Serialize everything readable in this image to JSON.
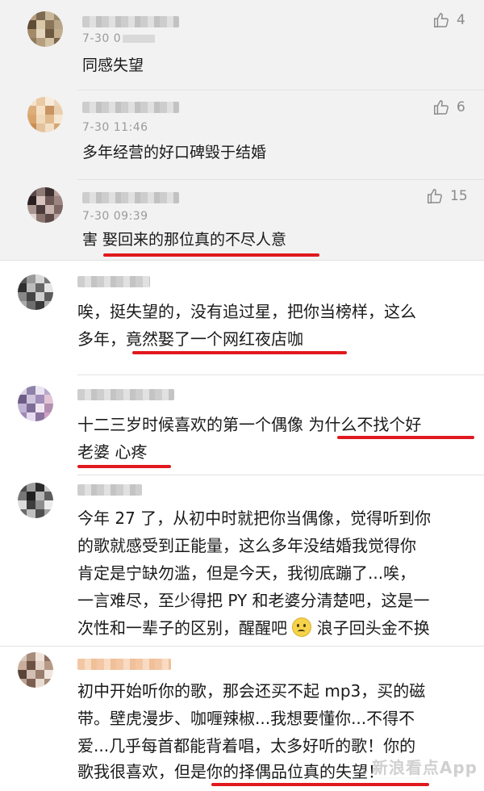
{
  "comments": [
    {
      "meta": "7-30 0",
      "likes": "4",
      "text": "同感失望"
    },
    {
      "meta": "7-30 11:46",
      "likes": "6",
      "text": "多年经营的好口碑毁于结婚"
    },
    {
      "meta": "7-30 09:39",
      "likes": "15",
      "text": "害 娶回来的那位真的不尽人意"
    },
    {
      "line1": "唉，挺失望的，没有追过星，把你当榜样，这么",
      "line2": "多年，竟然娶了一个网红夜店咖"
    },
    {
      "line1": "十二三岁时候喜欢的第一个偶像 为什么不找个好",
      "line2": "老婆 心疼"
    },
    {
      "line1": "今年 27 了，从初中时就把你当偶像，觉得听到你",
      "line2": "的歌就感受到正能量，这么多年没结婚我觉得你",
      "line3": "肯定是宁缺勿滥，但是今天，我彻底蹦了...唉，",
      "line4": "一言难尽，至少得把 PY 和老婆分清楚吧，这是一",
      "line5a": "次性和一辈子的区别，醒醒吧",
      "line5b": "浪子回头金不换"
    },
    {
      "line1": "初中开始听你的歌，那会还买不起 mp3，买的磁",
      "line2": "带。壁虎漫步、咖喱辣椒...我想要懂你...不得不",
      "line3": "爱...几乎每首都能背着唱，太多好听的歌！你的",
      "line4": "歌我很喜欢，但是你的择偶品位真的失望！"
    }
  ],
  "watermark": "新浪看点App",
  "colors": {
    "underline": "#e0191e",
    "gray_bg": "#f2f2f2",
    "meta": "#9a9a9a"
  },
  "icons": {
    "like": "thumbs-up-icon",
    "emoji": "worried-face-emoji"
  }
}
